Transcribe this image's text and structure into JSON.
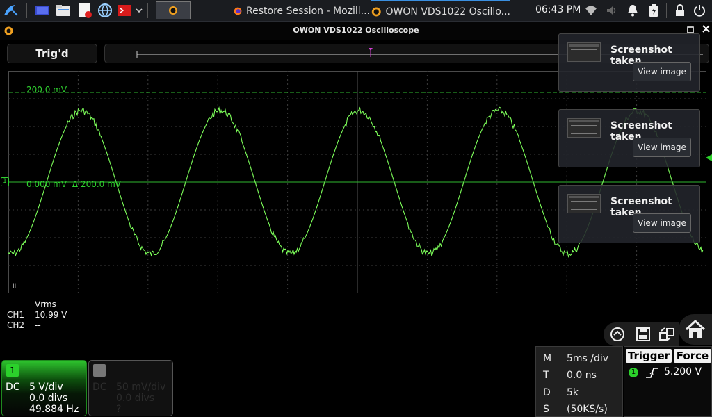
{
  "taskbar": {
    "tasks": [
      {
        "label": "Restore Session - Mozill..."
      },
      {
        "label": "OWON VDS1022 Oscillo..."
      }
    ],
    "clock": "06:43 PM"
  },
  "window": {
    "title": "OWON VDS1022 Oscilloscope"
  },
  "scope": {
    "trigger_status": "Trig'd",
    "ref_high_label": "200.0 mV",
    "ref_zero_label": "0.000 mV",
    "delta_label": "Δ 200.0 mV",
    "channel_marker": "1",
    "ch2_marker": "II"
  },
  "measurements": {
    "header": "Vrms",
    "rows": [
      {
        "channel": "CH1",
        "value": "10.99 V"
      },
      {
        "channel": "CH2",
        "value": "--"
      }
    ]
  },
  "notifications": [
    {
      "title": "Screenshot taken",
      "button": "View image"
    },
    {
      "title": "Screenshot taken",
      "button": "View image"
    },
    {
      "title": "Screenshot taken",
      "button": "View image"
    }
  ],
  "channels": [
    {
      "id": "1",
      "coupling": "DC",
      "volts_div": "5 V/div",
      "offset": "0.0 divs",
      "freq": "49.884 Hz"
    },
    {
      "id": "2",
      "coupling": "DC",
      "volts_div": "50 mV/div",
      "offset": "0.0 divs",
      "freq": "?"
    }
  ],
  "timebase": {
    "rows": [
      {
        "key": "M",
        "value": "5ms /div"
      },
      {
        "key": "T",
        "value": "0.0 ns"
      },
      {
        "key": "D",
        "value": "5k"
      },
      {
        "key": "S",
        "value": "(50KS/s)"
      }
    ]
  },
  "trigger": {
    "tab_trigger": "Trigger",
    "tab_force": "Force",
    "channel": "1",
    "level": "5.200 V"
  },
  "colors": {
    "trace": "#7dff5a",
    "grid": "#3b3b3b",
    "ref_line": "#2fb82f",
    "ch1": "#2bd12b",
    "accent": "#3a8fe0"
  },
  "icons": [
    "kali-dragon-icon",
    "workspace-icon",
    "files-icon",
    "text-editor-icon",
    "browser-icon",
    "terminal-icon",
    "chevron-down-icon",
    "firefox-icon",
    "owon-icon",
    "wifi-icon",
    "volume-icon",
    "bell-icon",
    "battery-icon",
    "lock-icon",
    "power-icon",
    "home-icon",
    "save-icon",
    "swap-icon",
    "auto-set-icon"
  ]
}
